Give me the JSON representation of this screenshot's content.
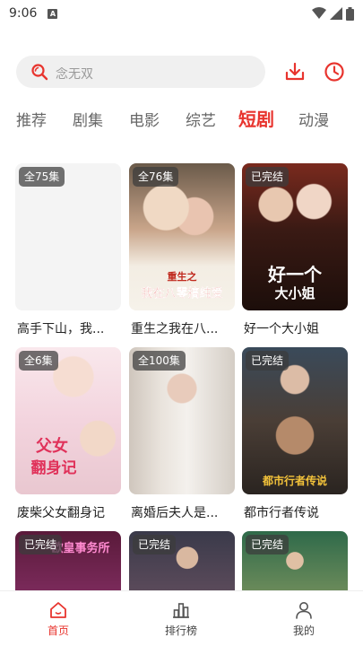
{
  "status_bar": {
    "time": "9:06",
    "notification": "A"
  },
  "search": {
    "placeholder": "念无双"
  },
  "tabs": [
    {
      "label": "推荐"
    },
    {
      "label": "剧集"
    },
    {
      "label": "电影"
    },
    {
      "label": "综艺"
    },
    {
      "label": "短剧"
    },
    {
      "label": "动漫"
    }
  ],
  "active_tab": "短剧",
  "cards": [
    {
      "badge": "全75集",
      "title": "高手下山，我..."
    },
    {
      "badge": "全76集",
      "title": "重生之我在八...",
      "poster_text_1": "重生之",
      "poster_text_2": "我在八零搞纯爱"
    },
    {
      "badge": "已完结",
      "title": "好一个大小姐",
      "poster_text_1": "好一个",
      "poster_text_2": "大小姐"
    },
    {
      "badge": "全6集",
      "title": "废柴父女翻身记",
      "poster_text_1": "父女",
      "poster_text_2": "翻身记"
    },
    {
      "badge": "全100集",
      "title": "离婚后夫人是..."
    },
    {
      "badge": "已完结",
      "title": "都市行者传说",
      "poster_text_1": "都市行者传说"
    },
    {
      "badge": "已完结",
      "poster_text_1": "欧皇事务所"
    },
    {
      "badge": "已完结"
    },
    {
      "badge": "已完结"
    }
  ],
  "bottom_nav": [
    {
      "label": "首页"
    },
    {
      "label": "排行榜"
    },
    {
      "label": "我的"
    }
  ],
  "colors": {
    "accent": "#e8342e"
  }
}
